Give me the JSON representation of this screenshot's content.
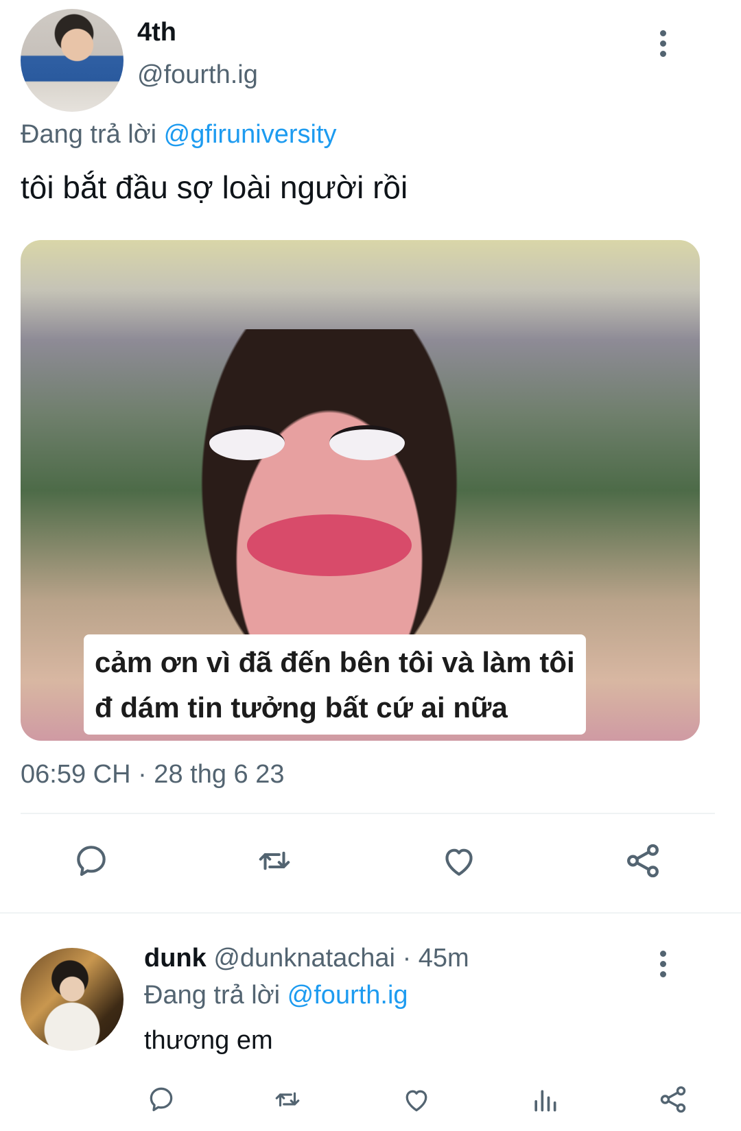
{
  "main_tweet": {
    "display_name": "4th",
    "handle": "@fourth.ig",
    "replying_prefix": "Đang trả lời",
    "replying_to": "@gfiruniversity",
    "text": "tôi bắt đầu sợ loài người rồi",
    "media_caption_line1": "cảm ơn vì đã đến bên tôi và làm tôi",
    "media_caption_line2": "đ dám tin tưởng bất cứ ai nữa",
    "timestamp": "06:59 CH · 28 thg 6 23"
  },
  "reply_tweet": {
    "display_name": "dunk",
    "handle": "@dunknatachai",
    "age": "· 45m",
    "replying_prefix": "Đang trả lời",
    "replying_to": "@fourth.ig",
    "text": "thương em"
  },
  "icons": {
    "reply": "reply-icon",
    "retweet": "retweet-icon",
    "like": "heart-icon",
    "share": "share-icon",
    "analytics": "analytics-icon",
    "more": "more-vertical-icon"
  },
  "colors": {
    "text": "#0f1419",
    "secondary": "#536471",
    "link": "#1d9bf0",
    "divider": "#eff3f4"
  }
}
